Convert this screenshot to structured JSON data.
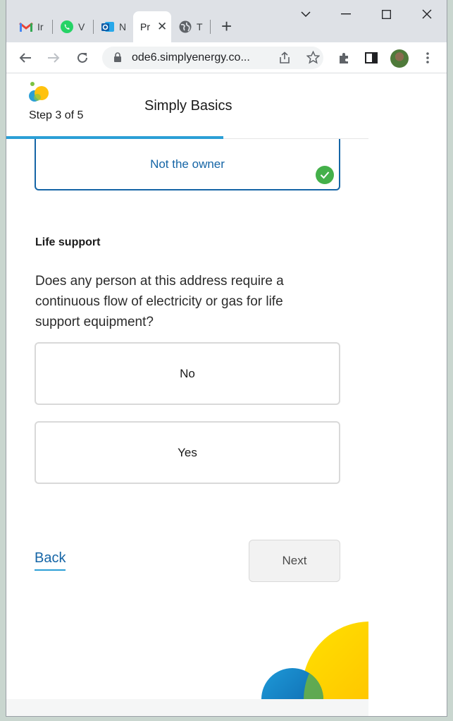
{
  "browser": {
    "tabs": [
      {
        "title": "Inbox",
        "short": "Ir",
        "icon": "gmail-icon"
      },
      {
        "title": "WhatsApp",
        "short": "V",
        "icon": "whatsapp-icon"
      },
      {
        "title": "Mail",
        "short": "N",
        "icon": "outlook-icon"
      },
      {
        "title": "Pr",
        "short": "Pr",
        "icon": "page-icon",
        "active": true
      },
      {
        "title": "T",
        "short": "T",
        "icon": "globe-icon"
      }
    ],
    "url": "ode6.simplyenergy.co...",
    "colors": {
      "tabstrip": "#dee1e6",
      "omnibox": "#f1f3f4"
    }
  },
  "header": {
    "step": "Step 3 of 5",
    "app_name": "Simply Basics"
  },
  "ownership": {
    "selected_option": "Not the owner"
  },
  "life_support": {
    "section_label": "Life support",
    "question": "Does any person at this address require a continuous flow of electricity or gas for life support equipment?",
    "options": [
      "No",
      "Yes"
    ]
  },
  "nav": {
    "back_label": "Back",
    "next_label": "Next"
  },
  "theme": {
    "primary": "#1565a6",
    "accent": "#2b9fd6",
    "success": "#44b04a",
    "sun": "#ffd400"
  }
}
